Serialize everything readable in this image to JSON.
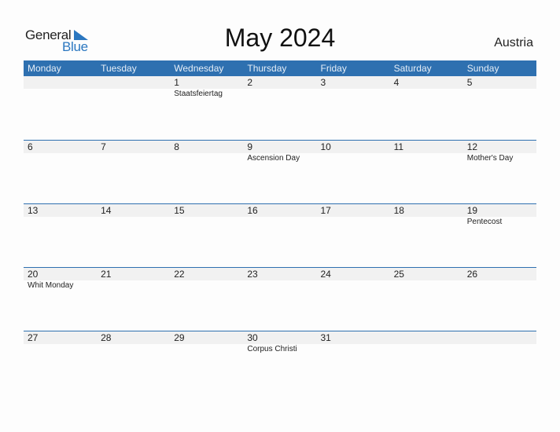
{
  "logo": {
    "line1": "General",
    "line2": "Blue"
  },
  "title": "May 2024",
  "country": "Austria",
  "weekdays": [
    "Monday",
    "Tuesday",
    "Wednesday",
    "Thursday",
    "Friday",
    "Saturday",
    "Sunday"
  ],
  "weeks": [
    {
      "days": [
        "",
        "",
        "1",
        "2",
        "3",
        "4",
        "5"
      ],
      "events": [
        "",
        "",
        "Staatsfeiertag",
        "",
        "",
        "",
        ""
      ]
    },
    {
      "days": [
        "6",
        "7",
        "8",
        "9",
        "10",
        "11",
        "12"
      ],
      "events": [
        "",
        "",
        "",
        "Ascension Day",
        "",
        "",
        "Mother's Day"
      ]
    },
    {
      "days": [
        "13",
        "14",
        "15",
        "16",
        "17",
        "18",
        "19"
      ],
      "events": [
        "",
        "",
        "",
        "",
        "",
        "",
        "Pentecost"
      ]
    },
    {
      "days": [
        "20",
        "21",
        "22",
        "23",
        "24",
        "25",
        "26"
      ],
      "events": [
        "Whit Monday",
        "",
        "",
        "",
        "",
        "",
        ""
      ]
    },
    {
      "days": [
        "27",
        "28",
        "29",
        "30",
        "31",
        "",
        ""
      ],
      "events": [
        "",
        "",
        "",
        "Corpus Christi",
        "",
        "",
        ""
      ]
    }
  ],
  "colors": {
    "header": "#2e70b0",
    "brand_blue": "#2b77c0",
    "day_row": "#f1f1f1"
  }
}
